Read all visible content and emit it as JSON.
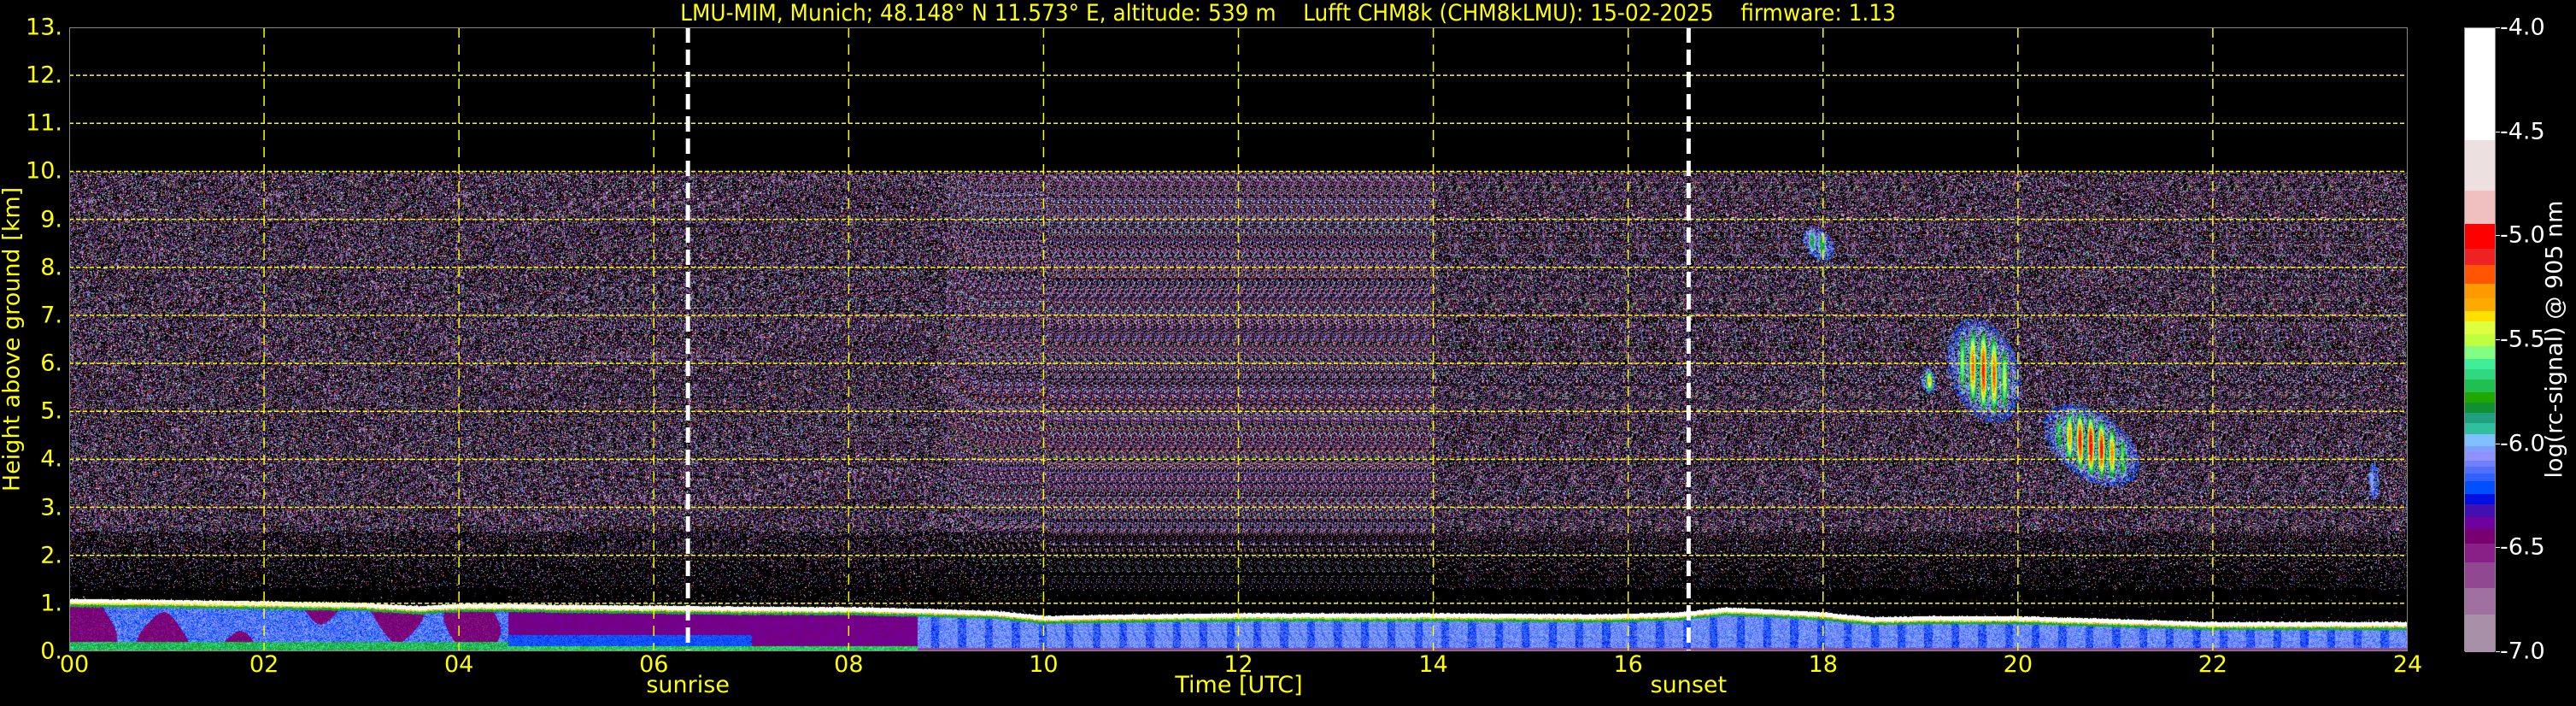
{
  "chart_data": {
    "type": "heatmap",
    "title": "LMU-MIM, Munich; 48.148° N 11.573° E, altitude: 539 m    Lufft CHM8k (CHM8kLMU): 15-02-2025    firmware: 1.13",
    "xlabel": "Time [UTC]",
    "ylabel": "Height above ground [km]",
    "xlim": [
      0,
      24
    ],
    "ylim": [
      0,
      13
    ],
    "x_ticks": [
      0,
      2,
      4,
      6,
      8,
      10,
      12,
      14,
      16,
      18,
      20,
      22,
      24
    ],
    "x_tick_labels": [
      "00",
      "02",
      "04",
      "06",
      "08",
      "10",
      "12",
      "14",
      "16",
      "18",
      "20",
      "22",
      "24"
    ],
    "y_ticks": [
      0,
      1,
      2,
      3,
      4,
      5,
      6,
      7,
      8,
      9,
      10,
      11,
      12,
      13
    ],
    "y_tick_labels": [
      "0.",
      "1.",
      "2.",
      "3.",
      "4.",
      "5.",
      "6.",
      "7.",
      "8.",
      "9.",
      "10.",
      "11.",
      "12.",
      "13."
    ],
    "grid": true,
    "grid_color": "#ffff00",
    "data_top_km": 10,
    "annotations": [
      {
        "label": "sunrise",
        "time_h": 6.35
      },
      {
        "label": "sunset",
        "time_h": 16.62
      }
    ],
    "boundary_layer_top_km": {
      "time_h": [
        0,
        1,
        2,
        3,
        3.6,
        4,
        4.5,
        5,
        6,
        7,
        8,
        8.7,
        9.5,
        10,
        11,
        12,
        14,
        15.8,
        16.5,
        17,
        17.5,
        18,
        18.5,
        19,
        20,
        21,
        22,
        24
      ],
      "height_km": [
        1.1,
        1.08,
        1.05,
        1.02,
        0.95,
        1.0,
        1.0,
        0.98,
        0.96,
        0.94,
        0.93,
        0.9,
        0.85,
        0.75,
        0.78,
        0.8,
        0.8,
        0.78,
        0.82,
        0.92,
        0.88,
        0.82,
        0.72,
        0.74,
        0.74,
        0.68,
        0.62,
        0.62
      ]
    },
    "cloud_features": [
      {
        "time_h": [
          19.0,
          19.15
        ],
        "height_km": [
          5.4,
          5.9
        ],
        "peak_log_signal": -5.3
      },
      {
        "time_h": [
          19.3,
          20.0
        ],
        "height_km": [
          4.9,
          6.8
        ],
        "peak_log_signal": -5.05
      },
      {
        "time_h": [
          20.3,
          21.2
        ],
        "height_km": [
          3.6,
          5.0
        ],
        "peak_log_signal": -4.95
      },
      {
        "time_h": [
          17.8,
          18.1
        ],
        "height_km": [
          8.2,
          8.8
        ],
        "peak_log_signal": -5.7
      },
      {
        "time_h": [
          23.6,
          23.7
        ],
        "height_km": [
          3.2,
          3.9
        ],
        "peak_log_signal": -5.9
      }
    ],
    "colorbar": {
      "label": "log(rc-signal) @ 905 nm",
      "range": [
        -7.0,
        -4.0
      ],
      "ticks": [
        -4.0,
        -4.5,
        -5.0,
        -5.5,
        -6.0,
        -6.5,
        -7.0
      ],
      "tick_labels": [
        "-4.0",
        "-4.5",
        "-5.0",
        "-5.5",
        "-6.0",
        "-6.5",
        "-7.0"
      ],
      "lower_bounds": [
        -4.54,
        -4.78,
        -4.94,
        -5.06,
        -5.14,
        -5.23,
        -5.3,
        -5.36,
        -5.41,
        -5.47,
        -5.53,
        -5.59,
        -5.64,
        -5.69,
        -5.75,
        -5.8,
        -5.85,
        -5.9,
        -5.95,
        -6.01,
        -6.04,
        -6.08,
        -6.11,
        -6.14,
        -6.18,
        -6.24,
        -6.29,
        -6.35,
        -6.41,
        -6.48,
        -6.57,
        -6.69,
        -6.82,
        -7.0
      ],
      "colors": [
        "#ffffff",
        "#ece0e0",
        "#f0c0c0",
        "#ff0000",
        "#ee2222",
        "#ff5500",
        "#ff9900",
        "#ffaa00",
        "#ffe000",
        "#e0ff40",
        "#c0ff40",
        "#80ff80",
        "#40ee99",
        "#30d880",
        "#20c050",
        "#20a800",
        "#109030",
        "#20a080",
        "#30c0a0",
        "#80c0ff",
        "#80a0ff",
        "#9090ff",
        "#7080ff",
        "#5070ff",
        "#3060ff",
        "#0050ff",
        "#0010e0",
        "#4010b0",
        "#7000a0",
        "#780070",
        "#882088",
        "#904890",
        "#a070a0",
        "#a890a8"
      ]
    }
  }
}
